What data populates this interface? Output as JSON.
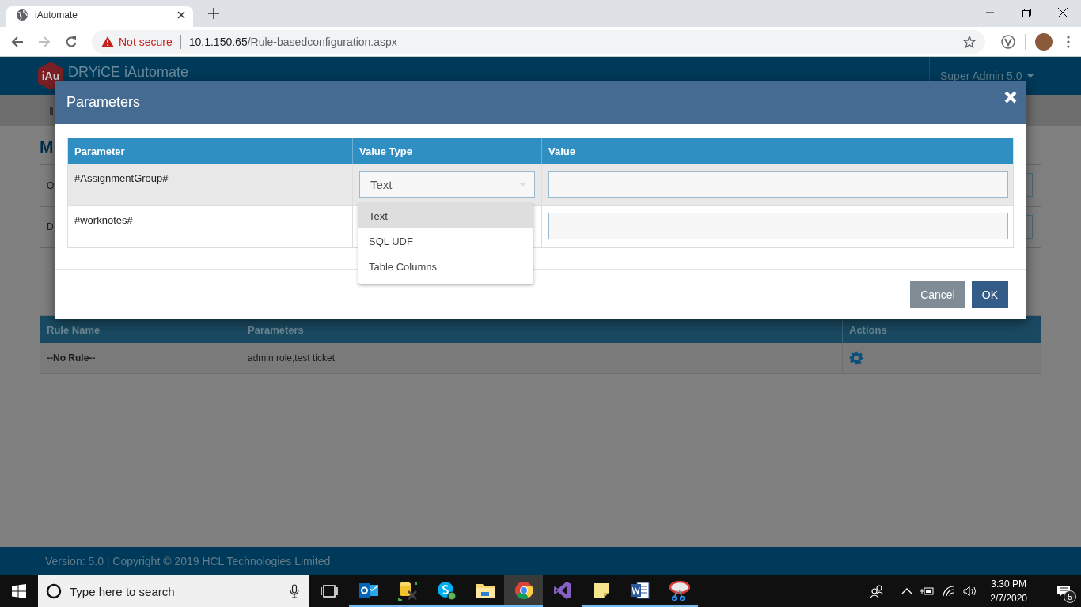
{
  "browser": {
    "tab_title": "iAutomate",
    "security_label": "Not secure",
    "url_host": "10.1.150.65",
    "url_path": "/Rule-basedconfiguration.aspx"
  },
  "app": {
    "logo_text": "iAu",
    "brand": "DRYiCE iAutomate",
    "user_menu": "Super Admin 5.0",
    "heading": "M",
    "form_labels": [
      "O",
      "D"
    ],
    "rules_table": {
      "columns": [
        "Rule Name",
        "Parameters",
        "Actions"
      ],
      "rows": [
        {
          "rule_name": "--No Rule--",
          "parameters": "admin role,test ticket"
        }
      ]
    },
    "footer": "Version: 5.0 | Copyright © 2019 HCL Technologies Limited"
  },
  "dialog": {
    "title": "Parameters",
    "columns": [
      "Parameter",
      "Value Type",
      "Value"
    ],
    "rows": [
      {
        "parameter": "#AssignmentGroup#",
        "value_type": "Text"
      },
      {
        "parameter": "#worknotes#"
      }
    ],
    "dropdown_options": [
      {
        "label": "Text",
        "selected": true
      },
      {
        "label": "SQL UDF",
        "selected": false
      },
      {
        "label": "Table Columns",
        "selected": false
      }
    ],
    "buttons": [
      {
        "label": "Cancel",
        "kind": "secondary"
      },
      {
        "label": "OK",
        "kind": "primary"
      }
    ]
  },
  "taskbar": {
    "search_placeholder": "Type here to search",
    "apps": [
      {
        "kind": "mail",
        "running": true,
        "selected": false
      },
      {
        "kind": "database",
        "running": true,
        "selected": false
      },
      {
        "kind": "chat",
        "running": true,
        "selected": false
      },
      {
        "kind": "folder",
        "running": true,
        "selected": false
      },
      {
        "kind": "browser",
        "running": true,
        "selected": true
      },
      {
        "kind": "code",
        "running": false,
        "selected": false
      },
      {
        "kind": "note",
        "running": true,
        "selected": false
      },
      {
        "kind": "document",
        "running": true,
        "selected": false
      },
      {
        "kind": "scissors",
        "running": true,
        "selected": false
      }
    ],
    "time": "3:30 PM",
    "date": "2/7/2020",
    "notification_count": "5"
  }
}
